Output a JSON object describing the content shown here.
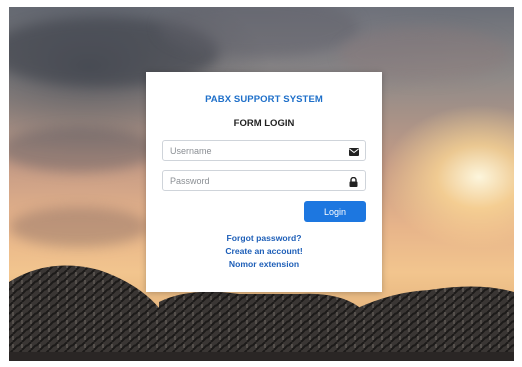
{
  "colors": {
    "accent": "#1d77e0",
    "title_blue": "#1e6fc9",
    "link_blue": "#1e5fb8"
  },
  "background": {
    "icon": "tires-sunset-photo"
  },
  "login_card": {
    "system_title": "PABX SUPPORT SYSTEM",
    "form_title": "FORM LOGIN",
    "username": {
      "placeholder": "Username",
      "value": "",
      "icon": "envelope-icon"
    },
    "password": {
      "placeholder": "Password",
      "value": "",
      "icon": "lock-icon"
    },
    "login_button": "Login",
    "links": {
      "forgot_password": "Forgot password?",
      "create_account": "Create an account!",
      "nomor_extension": "Nomor extension"
    }
  }
}
